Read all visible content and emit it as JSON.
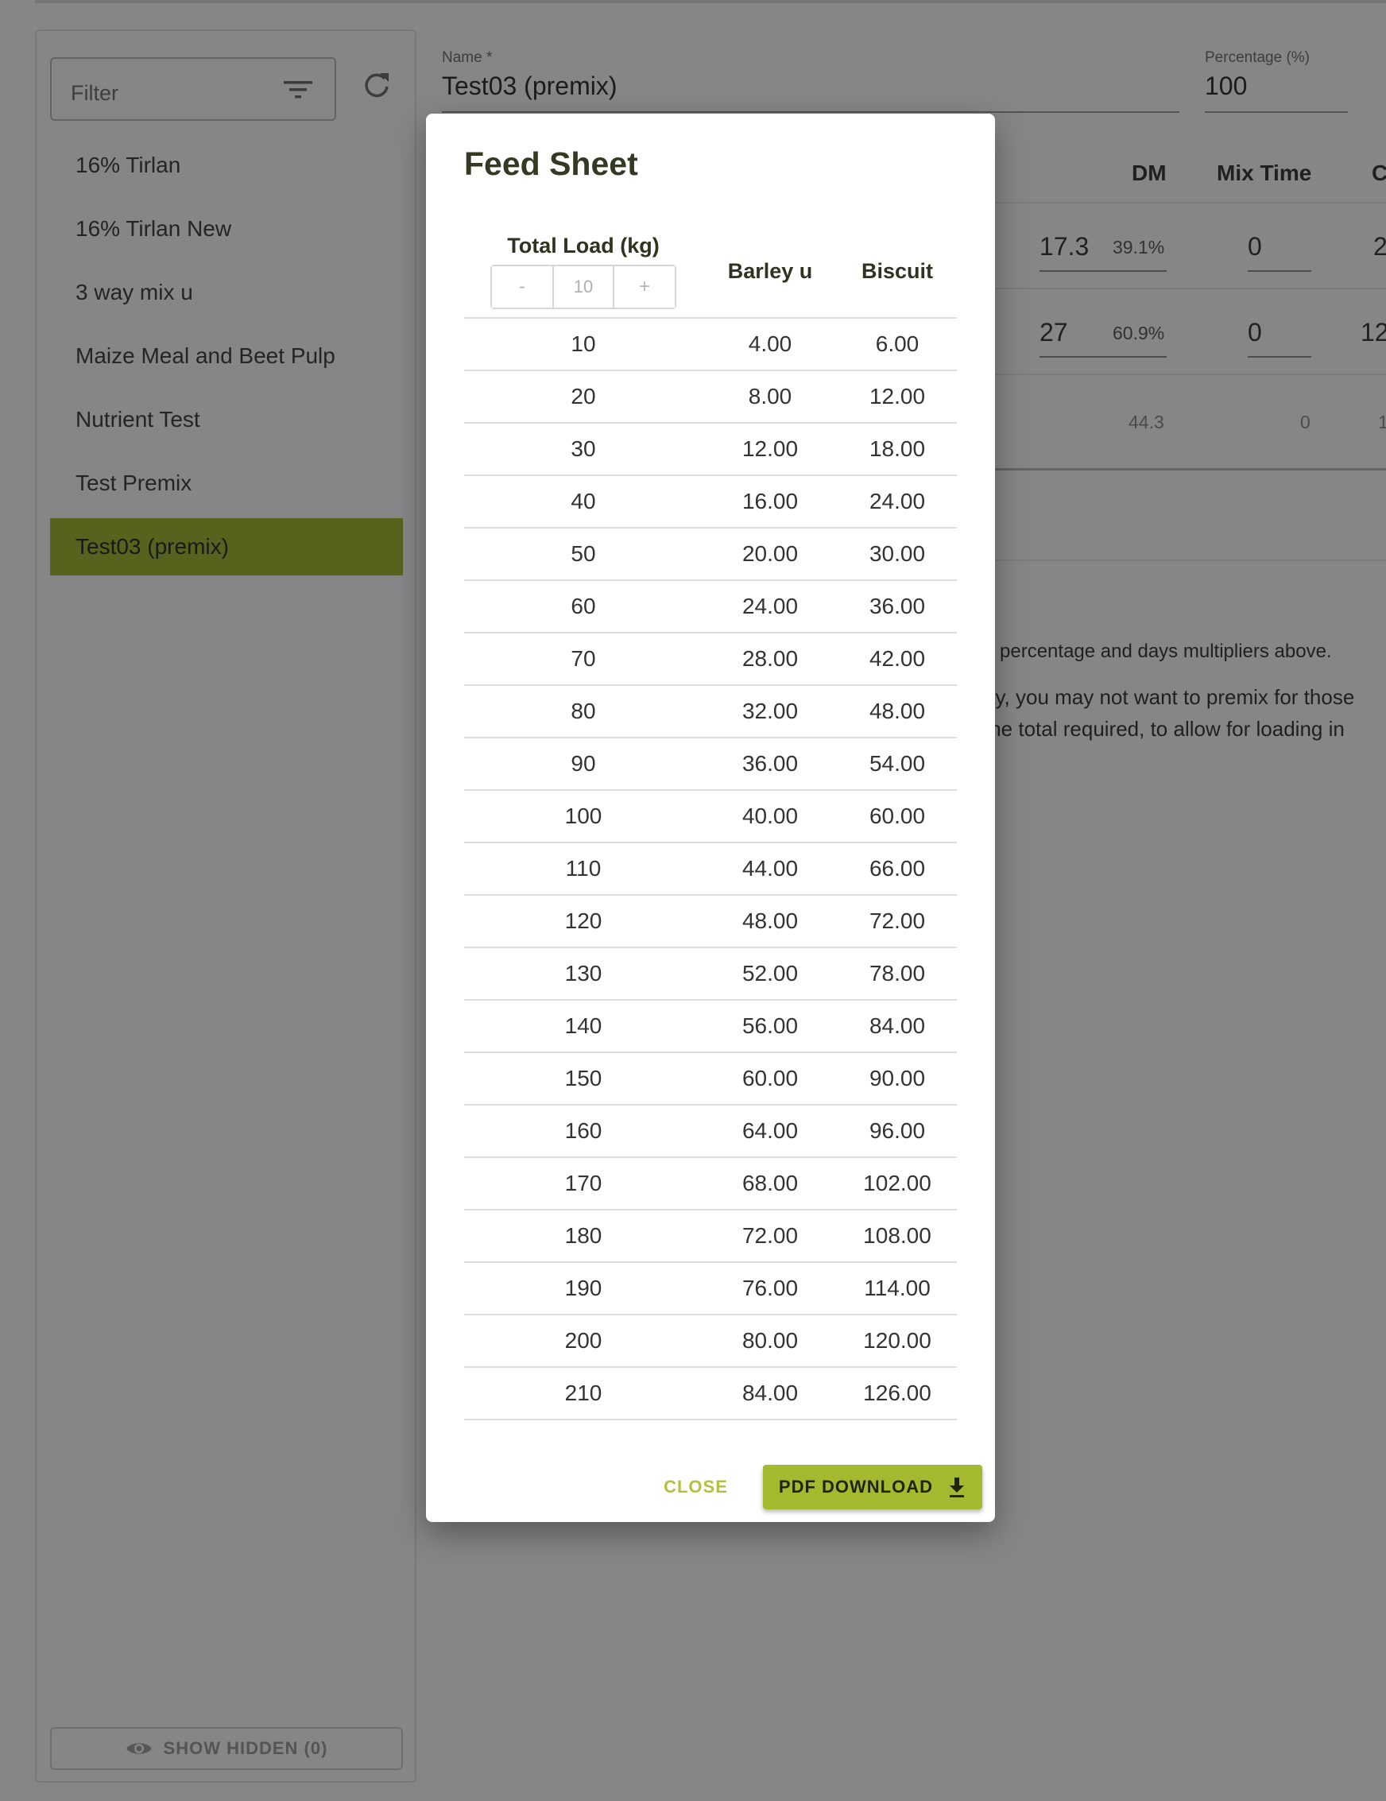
{
  "sidebar": {
    "filter_placeholder": "Filter",
    "mixes": [
      {
        "label": "16% Tirlan"
      },
      {
        "label": "16% Tirlan New"
      },
      {
        "label": "3 way mix u"
      },
      {
        "label": "Maize Meal and Beet Pulp"
      },
      {
        "label": "Nutrient Test"
      },
      {
        "label": "Test Premix"
      },
      {
        "label": "Test03 (premix)",
        "selected": true
      }
    ],
    "show_hidden_label": "SHOW HIDDEN (0)"
  },
  "form": {
    "name_label": "Name *",
    "name_value": "Test03 (premix)",
    "percentage_label": "Percentage (%)",
    "percentage_value": "100"
  },
  "mix_table": {
    "headers": {
      "dm": "DM",
      "mix_time": "Mix Time",
      "last_partial": "C"
    },
    "rows": [
      {
        "dm": "17.3",
        "dm_pct": "39.1%",
        "mix_time": "0",
        "last_partial": "2"
      },
      {
        "dm": "27",
        "dm_pct": "60.9%",
        "mix_time": "0",
        "last_partial": "12"
      }
    ],
    "totals": {
      "dm": "44.3",
      "mix_time": "0",
      "last_partial": "1"
    }
  },
  "info": {
    "line1": "e percentage and days multipliers above.",
    "line2": "ay, you may not want to premix for those",
    "line3": "the total required, to allow for loading in"
  },
  "modal": {
    "title": "Feed Sheet",
    "columns": {
      "load": "Total Load (kg)",
      "barley": "Barley u",
      "biscuit": "Biscuit"
    },
    "stepper": {
      "minus": "-",
      "placeholder": "10",
      "plus": "+"
    },
    "rows": [
      [
        "10",
        "4.00",
        "6.00"
      ],
      [
        "20",
        "8.00",
        "12.00"
      ],
      [
        "30",
        "12.00",
        "18.00"
      ],
      [
        "40",
        "16.00",
        "24.00"
      ],
      [
        "50",
        "20.00",
        "30.00"
      ],
      [
        "60",
        "24.00",
        "36.00"
      ],
      [
        "70",
        "28.00",
        "42.00"
      ],
      [
        "80",
        "32.00",
        "48.00"
      ],
      [
        "90",
        "36.00",
        "54.00"
      ],
      [
        "100",
        "40.00",
        "60.00"
      ],
      [
        "110",
        "44.00",
        "66.00"
      ],
      [
        "120",
        "48.00",
        "72.00"
      ],
      [
        "130",
        "52.00",
        "78.00"
      ],
      [
        "140",
        "56.00",
        "84.00"
      ],
      [
        "150",
        "60.00",
        "90.00"
      ],
      [
        "160",
        "64.00",
        "96.00"
      ],
      [
        "170",
        "68.00",
        "102.00"
      ],
      [
        "180",
        "72.00",
        "108.00"
      ],
      [
        "190",
        "76.00",
        "114.00"
      ],
      [
        "200",
        "80.00",
        "120.00"
      ],
      [
        "210",
        "84.00",
        "126.00"
      ]
    ],
    "close_label": "CLOSE",
    "pdf_label": "PDF DOWNLOAD"
  },
  "icons": {
    "filter": "filter-icon",
    "refresh": "refresh-icon",
    "eye": "eye-icon",
    "download": "download-icon"
  },
  "colors": {
    "accent": "#a4b828",
    "overlay": "#0a0e12"
  }
}
